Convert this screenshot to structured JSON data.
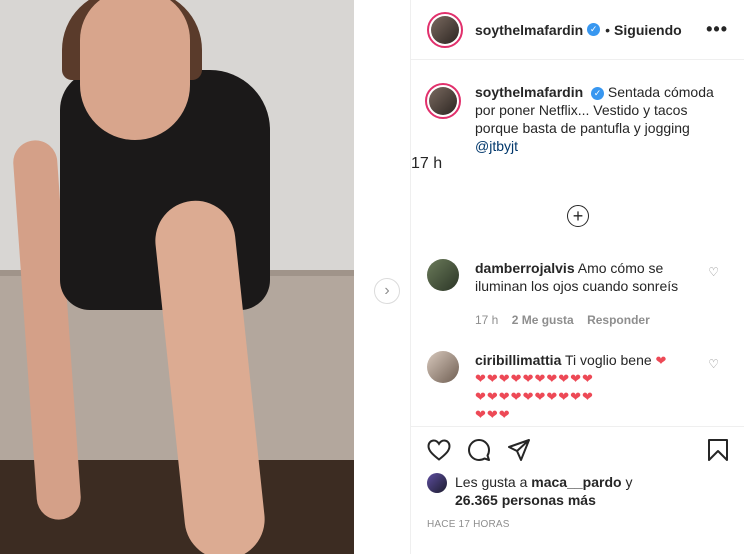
{
  "header": {
    "username": "soythelmafardin",
    "verified_mark": "✓",
    "separator": "•",
    "follow_label": "Siguiendo",
    "more_label": "•••"
  },
  "caption": {
    "username": "soythelmafardin",
    "text": "Sentada cómoda por poner Netflix... Vestido y tacos porque basta de pantufla y jogging",
    "mention": "@jtbyjt",
    "time": "17 h"
  },
  "load_more_label": "+",
  "comments": [
    {
      "username": "damberrojalvis",
      "text": "Amo cómo se iluminan los ojos cuando sonreís",
      "time": "17 h",
      "likes": "2 Me gusta",
      "reply": "Responder"
    },
    {
      "username": "ciribillimattia",
      "text": "Ti voglio bene",
      "hearts_line1": "❤",
      "hearts_line2": "❤❤❤❤❤❤❤❤❤❤",
      "hearts_line3": "❤❤❤❤❤❤❤❤❤❤",
      "hearts_line4": "❤❤❤"
    }
  ],
  "likes": {
    "prefix": "Les gusta a",
    "user": "maca__pardo",
    "conj": "y",
    "count": "26.365 personas más"
  },
  "posted_ago": "HACE 17 HORAS",
  "icons": {
    "like": "heart-icon",
    "comment": "comment-icon",
    "share": "share-icon",
    "save": "bookmark-icon",
    "next": "chevron-right-icon",
    "load_more": "plus-circle-icon"
  },
  "colors": {
    "accent": "#3897f0",
    "heart": "#ed4956",
    "muted": "#8e8e8e",
    "text": "#262626"
  }
}
